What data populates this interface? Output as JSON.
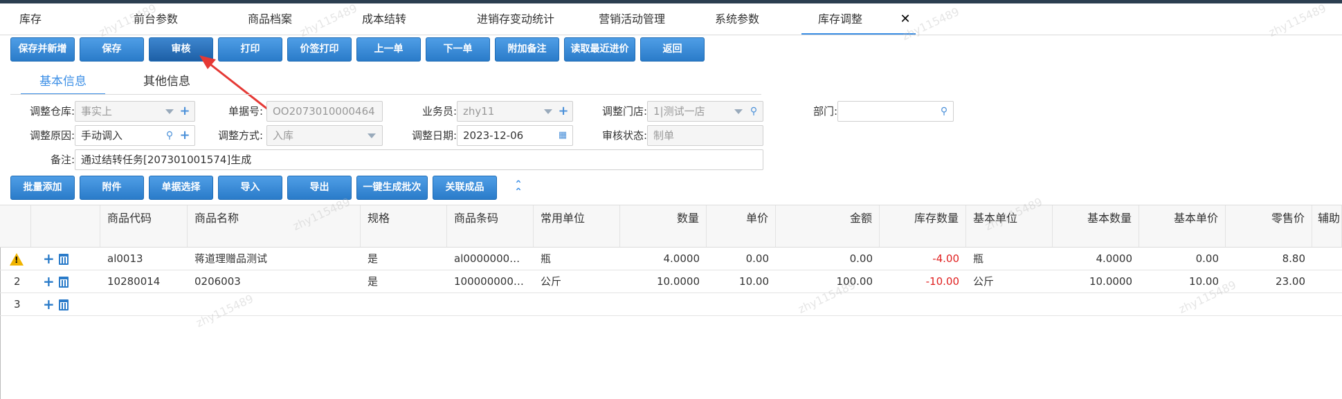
{
  "tabs": [
    {
      "label": "库存"
    },
    {
      "label": "前台参数"
    },
    {
      "label": "商品档案"
    },
    {
      "label": "成本结转"
    },
    {
      "label": "进销存变动统计"
    },
    {
      "label": "营销活动管理"
    },
    {
      "label": "系统参数"
    },
    {
      "label": "库存调整",
      "active": true
    }
  ],
  "tab_close": "✕",
  "toolbar": [
    {
      "label": "保存并新增"
    },
    {
      "label": "保存"
    },
    {
      "label": "审核"
    },
    {
      "label": "打印"
    },
    {
      "label": "价签打印"
    },
    {
      "label": "上一单"
    },
    {
      "label": "下一单"
    },
    {
      "label": "附加备注"
    },
    {
      "label": "读取最近进价"
    },
    {
      "label": "返回"
    }
  ],
  "subtabs": [
    {
      "label": "基本信息",
      "active": true
    },
    {
      "label": "其他信息"
    }
  ],
  "form": {
    "warehouse_label": "调整仓库:",
    "warehouse_value": "事实上",
    "doc_no_label": "单据号:",
    "doc_no_value": "OO2073010000464",
    "salesman_label": "业务员:",
    "salesman_value": "zhy11",
    "store_label": "调整门店:",
    "store_value": "1|测试一店",
    "dept_label": "部门:",
    "dept_value": "",
    "reason_label": "调整原因:",
    "reason_value": "手动调入",
    "mode_label": "调整方式:",
    "mode_value": "入库",
    "date_label": "调整日期:",
    "date_value": "2023-12-06",
    "audit_label": "审核状态:",
    "audit_value": "制单",
    "remark_label": "备注:",
    "remark_value": "通过结转任务[207301001574]生成"
  },
  "grid_toolbar": [
    {
      "label": "批量添加"
    },
    {
      "label": "附件"
    },
    {
      "label": "单据选择"
    },
    {
      "label": "导入"
    },
    {
      "label": "导出"
    },
    {
      "label": "一键生成批次"
    },
    {
      "label": "关联成品"
    }
  ],
  "grid": {
    "columns": [
      "商品代码",
      "商品名称",
      "规格",
      "商品条码",
      "常用单位",
      "数量",
      "单价",
      "金额",
      "库存数量",
      "基本单位",
      "基本数量",
      "基本单价",
      "零售价",
      "辅助"
    ],
    "rows": [
      {
        "index": "",
        "warning": true,
        "code": "al0013",
        "name": "蒋道理赠品测试",
        "spec": "是",
        "barcode": "al0000000…",
        "unit": "瓶",
        "qty": "4.0000",
        "price": "0.00",
        "amount": "0.00",
        "stock": "-4.00",
        "base_unit": "瓶",
        "base_qty": "4.0000",
        "base_price": "0.00",
        "retail": "8.80"
      },
      {
        "index": "2",
        "warning": false,
        "code": "10280014",
        "name": "0206003",
        "spec": "是",
        "barcode": "100000000…",
        "unit": "公斤",
        "qty": "10.0000",
        "price": "10.00",
        "amount": "100.00",
        "stock": "-10.00",
        "base_unit": "公斤",
        "base_qty": "10.0000",
        "base_price": "10.00",
        "retail": "23.00"
      },
      {
        "index": "3",
        "warning": false,
        "code": "",
        "name": "",
        "spec": "",
        "barcode": "",
        "unit": "",
        "qty": "",
        "price": "",
        "amount": "",
        "stock": "",
        "base_unit": "",
        "base_qty": "",
        "base_price": "",
        "retail": ""
      }
    ]
  },
  "watermark": "zhy115489",
  "colors": {
    "accent": "#3a8ee6",
    "button": "#2a7bc9",
    "negative": "#e02020",
    "arrow": "#e53935"
  }
}
